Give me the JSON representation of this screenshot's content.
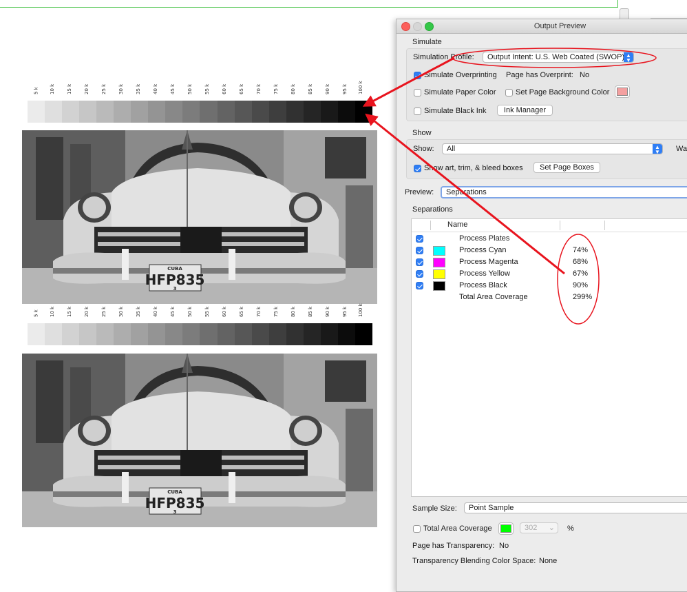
{
  "gray_ramp": {
    "tick_labels": [
      "5 k",
      "10 k",
      "15 k",
      "20 k",
      "25 k",
      "30 k",
      "35 k",
      "40 k",
      "45 k",
      "50 k",
      "55 k",
      "60 k",
      "65 k",
      "70 k",
      "75 k",
      "80 k",
      "85 k",
      "90 k",
      "95 k",
      "100 k"
    ],
    "levels_percent": [
      5,
      10,
      15,
      20,
      25,
      30,
      35,
      40,
      45,
      50,
      55,
      60,
      65,
      70,
      75,
      80,
      85,
      90,
      95,
      100
    ]
  },
  "photo": {
    "plate_top": "CUBA",
    "plate_main": "HFP835",
    "plate_bottom": "3"
  },
  "window": {
    "title": "Output Preview",
    "simulate": {
      "section": "Simulate",
      "profile_label": "Simulation Profile:",
      "profile_value": "Output Intent: U.S. Web Coated (SWOP)...",
      "overprint_label": "Simulate Overprinting",
      "overprint_checked": true,
      "has_overprint_label": "Page has Overprint:",
      "has_overprint_value": "No",
      "paper_color_label": "Simulate Paper Color",
      "paper_color_checked": false,
      "bg_color_label": "Set Page Background Color",
      "bg_color_checked": false,
      "bg_swatch_color": "#f4a0a0",
      "black_ink_label": "Simulate Black Ink",
      "black_ink_checked": false,
      "ink_manager_label": "Ink Manager"
    },
    "show": {
      "section": "Show",
      "show_label": "Show:",
      "show_value": "All",
      "warn_label": "War",
      "boxes_label": "Show art, trim, & bleed boxes",
      "boxes_checked": true,
      "set_boxes_label": "Set Page Boxes"
    },
    "preview": {
      "label": "Preview:",
      "value": "Separations"
    },
    "separations": {
      "section": "Separations",
      "col_name": "Name",
      "rows": [
        {
          "name": "Process Plates",
          "pct": "",
          "color": "",
          "checked": true
        },
        {
          "name": "Process Cyan",
          "pct": "74%",
          "color": "#00ffff",
          "checked": true
        },
        {
          "name": "Process Magenta",
          "pct": "68%",
          "color": "#ff00ff",
          "checked": true
        },
        {
          "name": "Process Yellow",
          "pct": "67%",
          "color": "#ffff00",
          "checked": true
        },
        {
          "name": "Process Black",
          "pct": "90%",
          "color": "#000000",
          "checked": true
        },
        {
          "name": "Total Area Coverage",
          "pct": "299%",
          "color": "",
          "checked": false
        }
      ]
    },
    "bottom": {
      "sample_size_label": "Sample Size:",
      "sample_size_value": "Point Sample",
      "tac_label": "Total Area Coverage",
      "tac_checked": false,
      "tac_swatch_color": "#00ff00",
      "tac_value": "302",
      "tac_unit": "%",
      "transparency_label": "Page has Transparency:",
      "transparency_value": "No",
      "blend_label": "Transparency Blending Color Space:",
      "blend_value": "None"
    }
  },
  "annotation_color": "#e8141e"
}
